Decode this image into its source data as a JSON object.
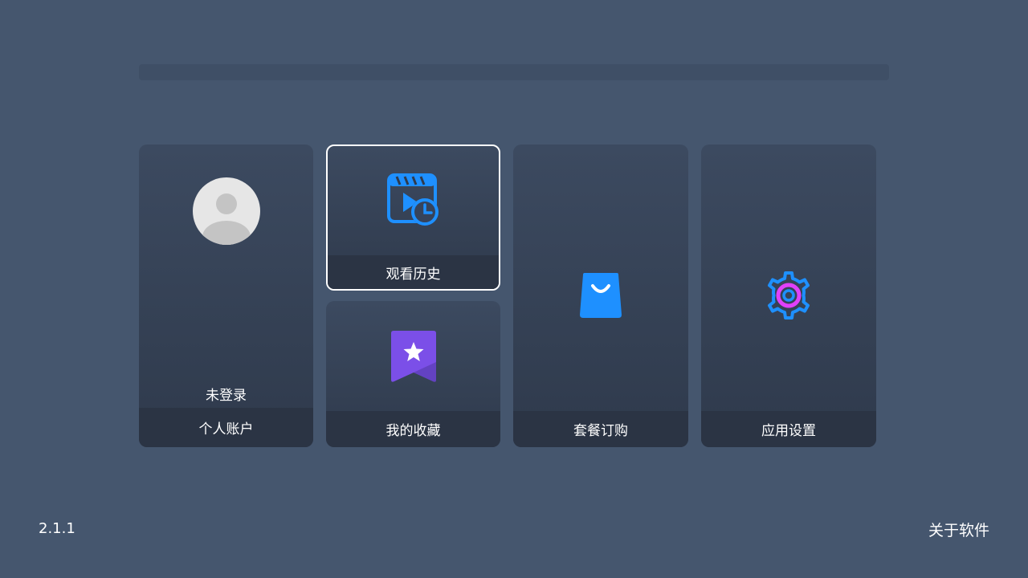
{
  "cards": {
    "account": {
      "status": "未登录",
      "label": "个人账户",
      "icon": "avatar-placeholder"
    },
    "history": {
      "label": "观看历史",
      "icon": "video-history-icon"
    },
    "favorites": {
      "label": "我的收藏",
      "icon": "bookmark-star-icon"
    },
    "subscription": {
      "label": "套餐订购",
      "icon": "shopping-bag-icon"
    },
    "settings": {
      "label": "应用设置",
      "icon": "gear-icon"
    }
  },
  "footer": {
    "version": "2.1.1",
    "about_label": "关于软件"
  },
  "colors": {
    "background": "#45566e",
    "accent_blue": "#1e90ff",
    "accent_purple": "#7b4fe8",
    "accent_pink": "#e040fb",
    "focus_border": "#ffffff"
  }
}
